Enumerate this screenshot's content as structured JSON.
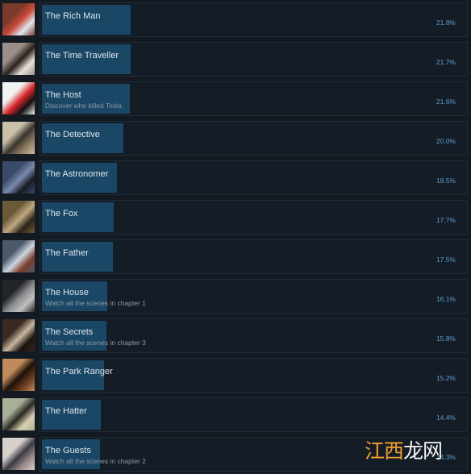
{
  "achievements": [
    {
      "name": "The Rich Man",
      "description": "",
      "percent": "21.8%",
      "value": 21.8,
      "icon": "rich-man-icon",
      "colors": [
        "#7a3a2a",
        "#c94a3a",
        "#dfe6f0"
      ]
    },
    {
      "name": "The Time Traveller",
      "description": "",
      "percent": "21.7%",
      "value": 21.7,
      "icon": "clock-icon",
      "colors": [
        "#9a8f88",
        "#2a201c",
        "#e8e4dc"
      ]
    },
    {
      "name": "The Host",
      "description": "Discover who killed Tesla",
      "percent": "21.6%",
      "value": 21.6,
      "icon": "host-icon",
      "colors": [
        "#f2f2f2",
        "#d8262a",
        "#111111"
      ]
    },
    {
      "name": "The Detective",
      "description": "",
      "percent": "20.0%",
      "value": 20.0,
      "icon": "detective-icon",
      "colors": [
        "#c9c0a8",
        "#3a3530",
        "#8a7a60"
      ]
    },
    {
      "name": "The Astronomer",
      "description": "",
      "percent": "18.5%",
      "value": 18.5,
      "icon": "telescope-icon",
      "colors": [
        "#3a4a6a",
        "#7a8ab0",
        "#1a1a24"
      ]
    },
    {
      "name": "The Fox",
      "description": "",
      "percent": "17.7%",
      "value": 17.7,
      "icon": "fox-icon",
      "colors": [
        "#6a5a3a",
        "#c0a880",
        "#2a2418"
      ]
    },
    {
      "name": "The Father",
      "description": "",
      "percent": "17.5%",
      "value": 17.5,
      "icon": "father-icon",
      "colors": [
        "#4a5a6a",
        "#cfd6de",
        "#7a3a2a"
      ]
    },
    {
      "name": "The House",
      "description": "Watch all the scenes in chapter 1",
      "percent": "16.1%",
      "value": 16.1,
      "icon": "house-icon",
      "colors": [
        "#222428",
        "#8a8c90",
        "#c0c0c0"
      ]
    },
    {
      "name": "The Secrets",
      "description": "Watch all the scenes in chapter 3",
      "percent": "15.8%",
      "value": 15.8,
      "icon": "secrets-icon",
      "colors": [
        "#3a2a22",
        "#c8b8a0",
        "#1a1410"
      ]
    },
    {
      "name": "The Park Ranger",
      "description": "",
      "percent": "15.2%",
      "value": 15.2,
      "icon": "skull-icon",
      "colors": [
        "#c08a5a",
        "#1a1008",
        "#6a3a20"
      ]
    },
    {
      "name": "The Hatter",
      "description": "",
      "percent": "14.4%",
      "value": 14.4,
      "icon": "hats-icon",
      "colors": [
        "#aab098",
        "#2a2a22",
        "#d8d0b0"
      ]
    },
    {
      "name": "The Guests",
      "description": "Watch all the scenes in chapter 2",
      "percent": "14.3%",
      "value": 14.3,
      "icon": "guests-icon",
      "colors": [
        "#d8d0cc",
        "#3a3a44",
        "#9a8a88"
      ]
    }
  ],
  "watermark": {
    "part1": "江西",
    "part2": "龙网"
  }
}
